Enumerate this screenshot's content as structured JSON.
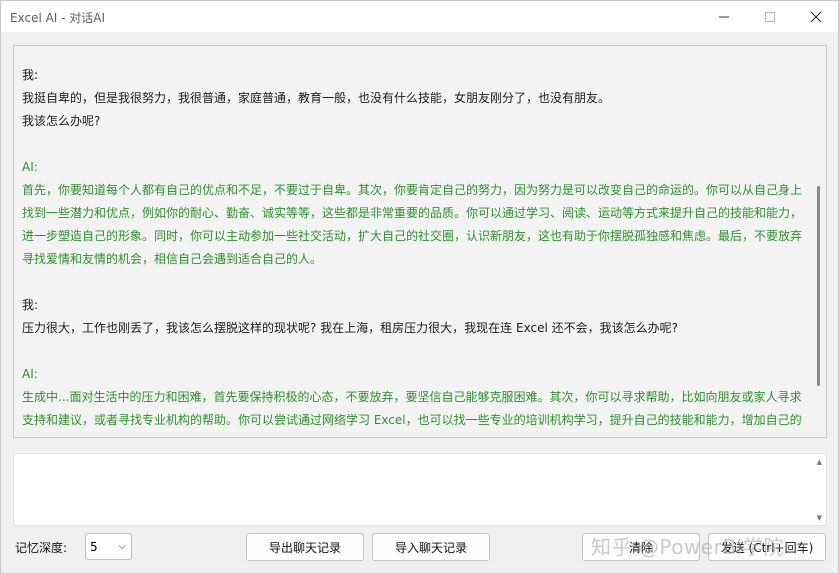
{
  "window": {
    "title": "Excel AI - 对话AI"
  },
  "chat": {
    "messages": [
      {
        "role": "user",
        "speaker": "我:",
        "lines": [
          "我挺自卑的，但是我很努力，我很普通，家庭普通，教育一般，也没有什么技能，女朋友刚分了，也没有朋友。",
          "我该怎么办呢?"
        ]
      },
      {
        "role": "ai",
        "speaker": "AI:",
        "lines": [
          "首先，你要知道每个人都有自己的优点和不足，不要过于自卑。其次，你要肯定自己的努力，因为努力是可以改变自己的命运的。你可以从自己身上找到一些潜力和优点，例如你的耐心、勤奋、诚实等等，这些都是非常重要的品质。你可以通过学习、阅读、运动等方式来提升自己的技能和能力，进一步塑造自己的形象。同时，你可以主动参加一些社交活动，扩大自己的社交圈，认识新朋友，这也有助于你摆脱孤独感和焦虑。最后，不要放弃寻找爱情和友情的机会，相信自己会遇到适合自己的人。"
        ]
      },
      {
        "role": "user",
        "speaker": "我:",
        "lines": [
          "压力很大，工作也刚丢了，我该怎么摆脱这样的现状呢? 我在上海，租房压力很大，我现在连 Excel 还不会，我该怎么办呢?"
        ]
      },
      {
        "role": "ai",
        "speaker": "AI:",
        "lines": [
          "生成中...面对生活中的压力和困难，首先要保持积极的心态，不要放弃，要坚信自己能够克服困难。其次，你可以寻求帮助，比如向朋友或家人寻求支持和建议，或者寻找专业机构的帮助。你可以尝试通过网络学习 Excel，也可以找一些专业的培训机构学习，提升自己的技能和能力，增加自己的"
        ]
      }
    ]
  },
  "input": {
    "value": ""
  },
  "controls": {
    "depth_label": "记忆深度:",
    "depth_value": "5",
    "export_label": "导出聊天记录",
    "import_label": "导入聊天记录",
    "clear_label": "清除",
    "send_label": "发送 (Ctrl+回车)"
  },
  "watermark": "知乎 @PowerBI学院",
  "colors": {
    "user_text": "#1a1a1a",
    "ai_text": "#2f8f2f"
  }
}
